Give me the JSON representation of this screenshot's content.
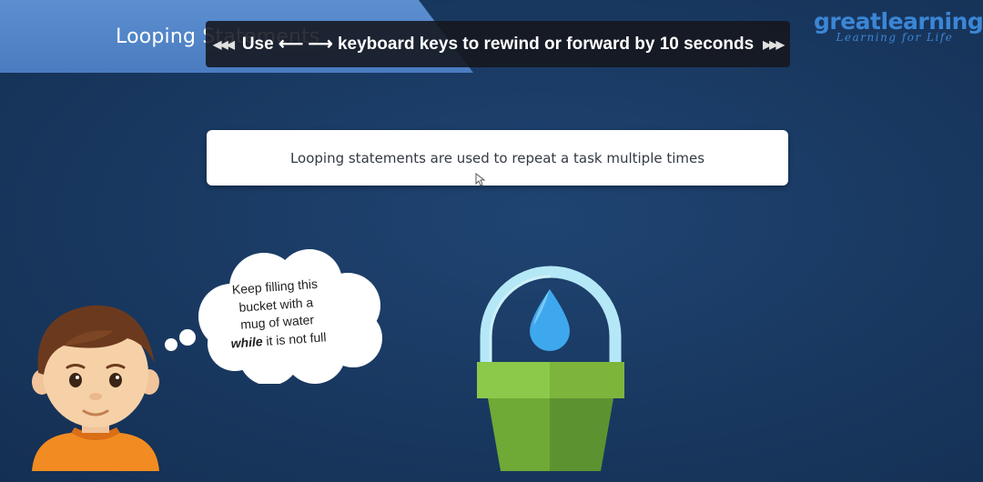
{
  "slide": {
    "title": "Looping Statements",
    "caption": "Looping statements are used to repeat a task multiple times"
  },
  "logo": {
    "word1": "great",
    "word2": "learning",
    "tagline": "Learning for Life"
  },
  "hint": {
    "text": "Use ⟵ ⟶ keyboard keys to rewind or forward by 10 seconds",
    "left_glyph": "◀◀◀",
    "right_glyph": "▶▶▶"
  },
  "thought": {
    "line1": "Keep filling this",
    "line2": "bucket with a",
    "line3": "mug of water",
    "keyword": "while",
    "line4_rest": " it is not full"
  },
  "colors": {
    "background": "#1a3a63",
    "banner": "#4a7cc0",
    "logo": "#3b86d6",
    "bucket_green": "#7db53c",
    "water_drop": "#3ea8ef"
  }
}
